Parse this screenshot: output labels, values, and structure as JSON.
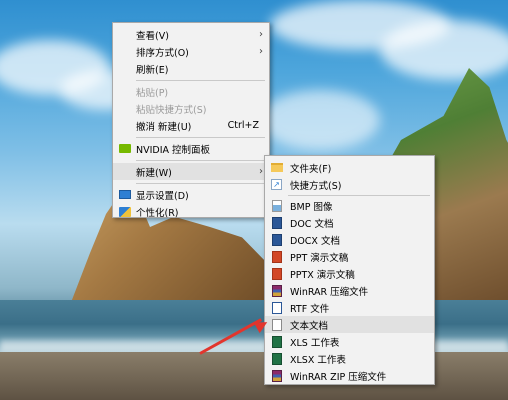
{
  "main_menu": {
    "items": [
      {
        "label": "查看(V)"
      },
      {
        "label": "排序方式(O)"
      },
      {
        "label": "刷新(E)"
      },
      {
        "label": "粘贴(P)"
      },
      {
        "label": "粘贴快捷方式(S)"
      },
      {
        "label": "撤消 新建(U)",
        "shortcut": "Ctrl+Z"
      },
      {
        "label": "NVIDIA 控制面板"
      },
      {
        "label": "新建(W)"
      },
      {
        "label": "显示设置(D)"
      },
      {
        "label": "个性化(R)"
      }
    ],
    "submenu_indicator": "›"
  },
  "new_submenu": {
    "items": [
      {
        "label": "文件夹(F)",
        "icon": "folder-icon"
      },
      {
        "label": "快捷方式(S)",
        "icon": "shortcut-icon"
      },
      {
        "label": "BMP 图像",
        "icon": "bmp-image-icon"
      },
      {
        "label": "DOC 文档",
        "icon": "word-doc-icon"
      },
      {
        "label": "DOCX 文档",
        "icon": "word-docx-icon"
      },
      {
        "label": "PPT 演示文稿",
        "icon": "powerpoint-icon"
      },
      {
        "label": "PPTX 演示文稿",
        "icon": "powerpoint-x-icon"
      },
      {
        "label": "WinRAR 压缩文件",
        "icon": "winrar-icon"
      },
      {
        "label": "RTF 文件",
        "icon": "rtf-icon"
      },
      {
        "label": "文本文档",
        "icon": "text-doc-icon"
      },
      {
        "label": "XLS 工作表",
        "icon": "excel-icon"
      },
      {
        "label": "XLSX 工作表",
        "icon": "excel-x-icon"
      },
      {
        "label": "WinRAR ZIP 压缩文件",
        "icon": "winrar-zip-icon"
      }
    ]
  },
  "colors": {
    "menu_bg": "#f2f2f2",
    "hover_bg": "#e1e1e1",
    "disabled_text": "#9a9a9a",
    "annotation_arrow": "#e2352d"
  }
}
